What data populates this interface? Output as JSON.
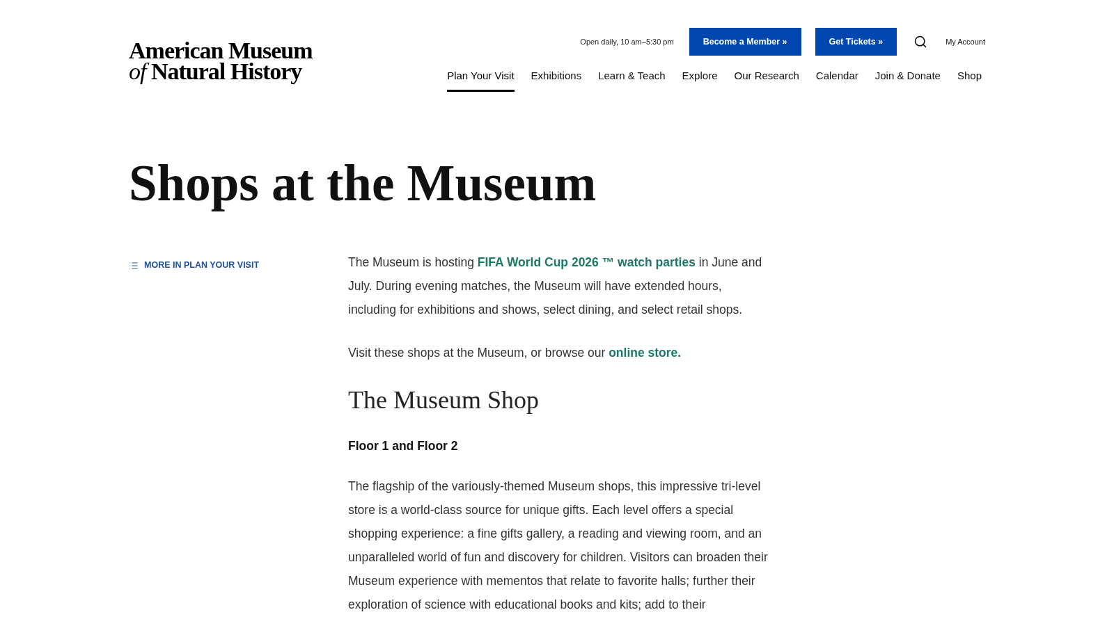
{
  "header": {
    "logo": {
      "line_1": "American Museum",
      "line_2_prefix": "of",
      "line_2": "Natural History"
    },
    "hours": "Open daily, 10 am–5:30 pm",
    "buttons": [
      "Become a Member »",
      "Get Tickets »"
    ],
    "account_link": "My Account",
    "nav": [
      {
        "label": "Plan Your Visit",
        "selected": true
      },
      {
        "label": "Exhibitions",
        "selected": false
      },
      {
        "label": "Learn & Teach",
        "selected": false
      },
      {
        "label": "Explore",
        "selected": false
      },
      {
        "label": "Our Research",
        "selected": false
      },
      {
        "label": "Calendar",
        "selected": false
      },
      {
        "label": "Join & Donate",
        "selected": false
      },
      {
        "label": "Shop",
        "selected": false
      }
    ]
  },
  "page_title": "Shops at the Museum",
  "sidebar": {
    "link": "MORE IN PLAN YOUR VISIT"
  },
  "content": [
    {
      "kind": "paragraph",
      "parts": [
        {
          "kind": "text",
          "text": "The Museum is hosting "
        },
        {
          "kind": "link",
          "text": "FIFA World Cup 2026 ™ watch parties"
        },
        {
          "kind": "text",
          "text": " in June and July. During evening matches, the Museum will have extended hours, including for exhibitions and shows, select dining, and select retail shops."
        }
      ]
    },
    {
      "kind": "paragraph",
      "parts": [
        {
          "kind": "text",
          "text": "Visit these shops at the Museum, or browse our "
        },
        {
          "kind": "link",
          "text": "online store."
        }
      ]
    },
    {
      "kind": "heading",
      "text": "The Museum Shop"
    },
    {
      "kind": "subheading",
      "text": "Floor 1 and Floor 2"
    },
    {
      "kind": "paragraph",
      "parts": [
        {
          "kind": "text",
          "text": "The flagship of the variously-themed Museum shops, this impressive tri-level store is a world-class source for unique gifts. Each level offers a special shopping experience: a fine gifts gallery, a reading and viewing room, and an unparalleled world of fun and discovery for children. Visitors can broaden their Museum experience with mementos that relate to favorite halls; further their exploration of science with educational books and kits; add to their"
        }
      ]
    }
  ]
}
